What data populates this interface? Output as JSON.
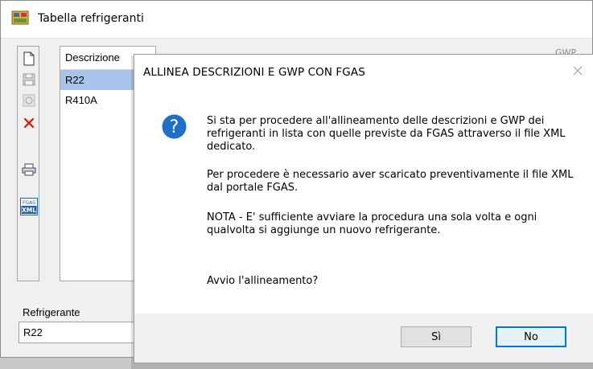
{
  "window": {
    "title": "Tabella refrigeranti",
    "app_icon": "app-logo-icon"
  },
  "toolbar": {
    "buttons": [
      {
        "icon": "new-document-icon"
      },
      {
        "icon": "save-icon"
      },
      {
        "icon": "disabled-icon"
      },
      {
        "icon": "delete-icon"
      },
      {
        "icon": "print-icon"
      },
      {
        "icon": "fgas-xml-icon",
        "text_top": "FGAS",
        "text_bottom": "XML"
      }
    ]
  },
  "list": {
    "header": "Descrizione",
    "rows": [
      "R22",
      "R410A"
    ],
    "selected_index": 0,
    "hidden_column_hint": "GWP"
  },
  "field": {
    "label": "Refrigerante",
    "value": "R22"
  },
  "dialog": {
    "title": "ALLINEA DESCRIZIONI E GWP CON FGAS",
    "icon": "question-icon",
    "messages": [
      "Si sta per procedere all'allineamento delle descrizioni e GWP dei refrigeranti in lista con quelle previste da FGAS attraverso il file XML dedicato.",
      "Per procedere è necessario aver scaricato preventivamente il file XML dal portale FGAS.",
      "NOTA - E' sufficiente avviare la procedura una sola volta e ogni qualvolta si aggiunge un nuovo refrigerante.",
      "Avvio l'allineamento?"
    ],
    "buttons": {
      "yes": "Sì",
      "no": "No"
    },
    "default_button": "no"
  },
  "colors": {
    "accent": "#0078d7",
    "selected_row": "#a9c3ea",
    "question_icon": "#1e6fc7",
    "delete_icon": "#e51400"
  }
}
